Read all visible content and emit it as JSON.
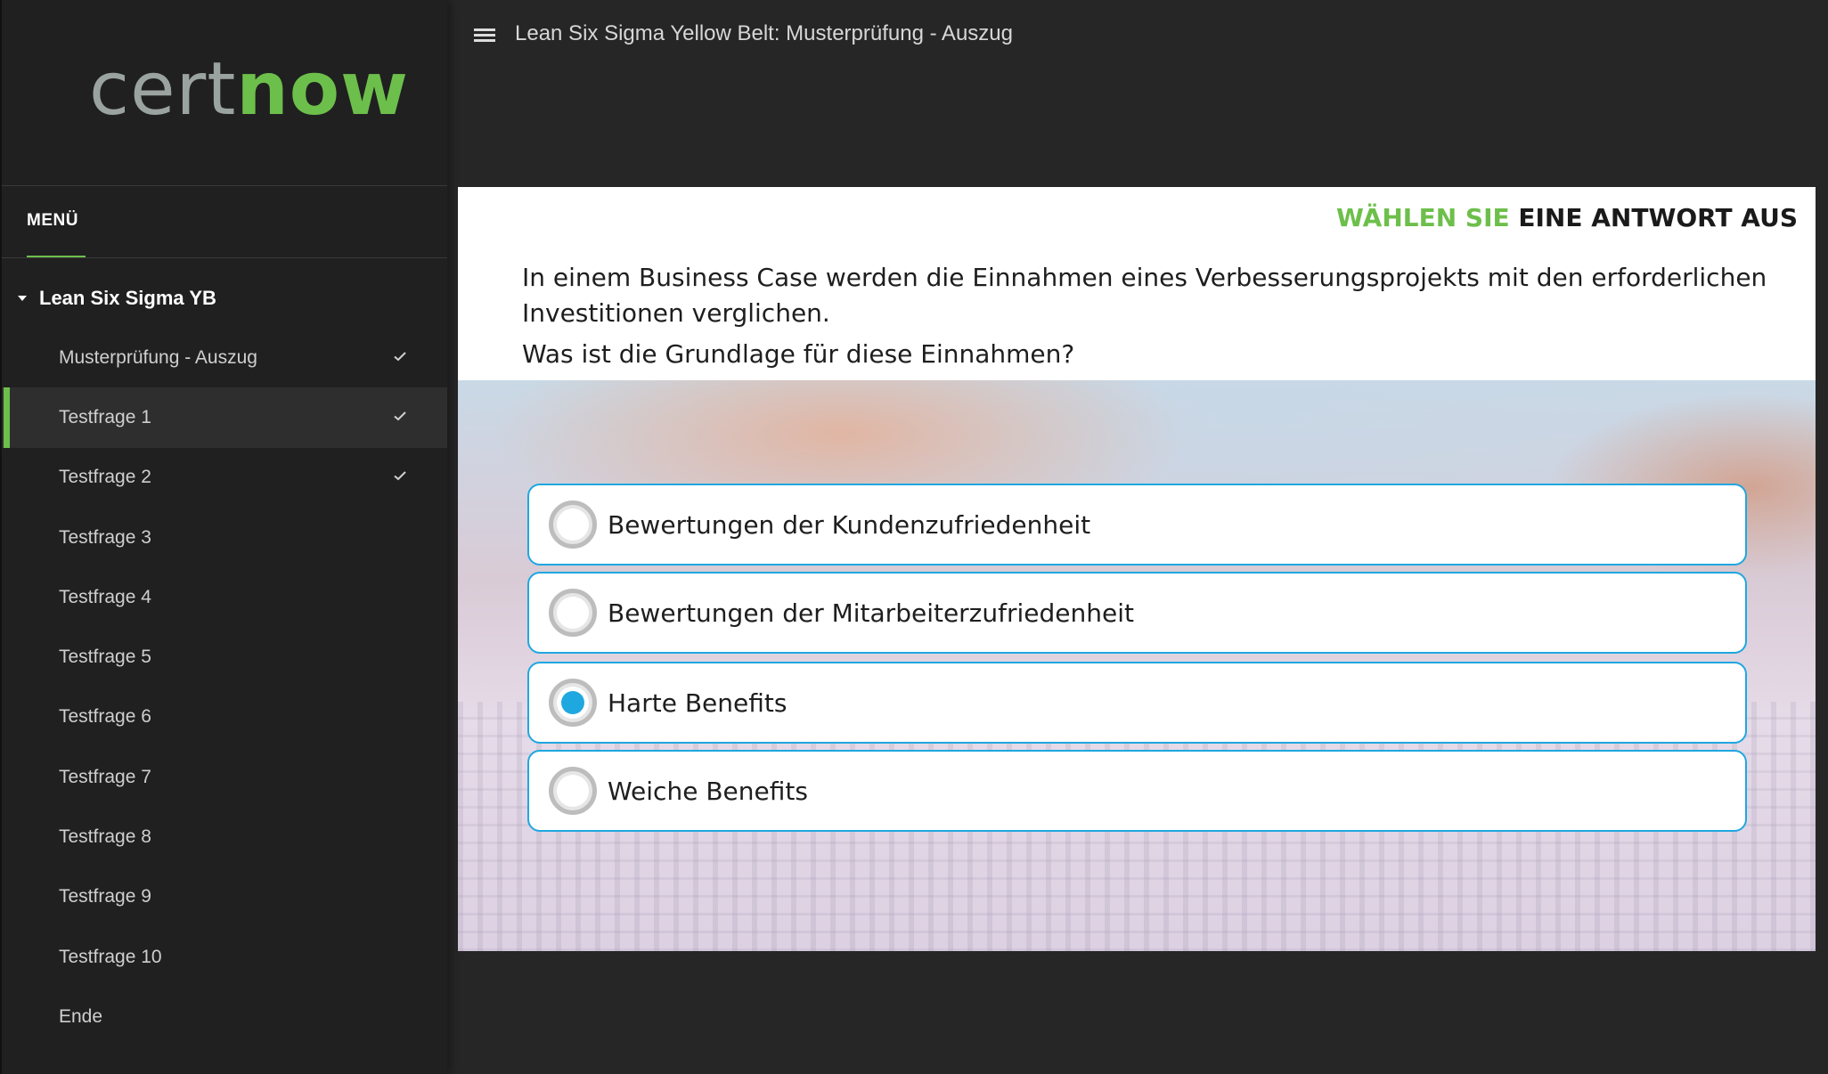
{
  "app": {
    "logo": {
      "part1": "cert",
      "part2": "now"
    },
    "course_title": "Lean Six Sigma Yellow Belt: Musterprüfung - Auszug"
  },
  "sidebar": {
    "menu_tab": "MENÜ",
    "section": "Lean Six Sigma YB",
    "items": [
      {
        "label": "Musterprüfung - Auszug",
        "completed": true,
        "active": false
      },
      {
        "label": "Testfrage 1",
        "completed": true,
        "active": true
      },
      {
        "label": "Testfrage 2",
        "completed": true,
        "active": false
      },
      {
        "label": "Testfrage 3",
        "completed": false,
        "active": false
      },
      {
        "label": "Testfrage 4",
        "completed": false,
        "active": false
      },
      {
        "label": "Testfrage 5",
        "completed": false,
        "active": false
      },
      {
        "label": "Testfrage 6",
        "completed": false,
        "active": false
      },
      {
        "label": "Testfrage 7",
        "completed": false,
        "active": false
      },
      {
        "label": "Testfrage 8",
        "completed": false,
        "active": false
      },
      {
        "label": "Testfrage 9",
        "completed": false,
        "active": false
      },
      {
        "label": "Testfrage 10",
        "completed": false,
        "active": false
      },
      {
        "label": "Ende",
        "completed": false,
        "active": false
      }
    ]
  },
  "question": {
    "instruction_highlight": "WÄHLEN SIE",
    "instruction_rest": "EINE ANTWORT AUS",
    "text_line1": "In einem Business Case werden die Einnahmen eines Verbesserungsprojekts mit den erforderlichen Investitionen verglichen.",
    "text_line2": "Was ist die Grundlage für diese Einnahmen?",
    "options": [
      {
        "label": "Bewertungen der Kundenzufriedenheit",
        "selected": false
      },
      {
        "label": "Bewertungen der Mitarbeiterzufriedenheit",
        "selected": false
      },
      {
        "label": "Harte Benefits",
        "selected": true
      },
      {
        "label": "Weiche Benefits",
        "selected": false
      }
    ]
  },
  "icons": {
    "menu": "hamburger-icon",
    "check": "checkmark-icon",
    "caret": "caret-down-icon"
  },
  "colors": {
    "accent_green": "#6dbf4b",
    "accent_blue": "#1fa7e0",
    "sidebar_bg": "#202020",
    "page_bg": "#262626"
  }
}
